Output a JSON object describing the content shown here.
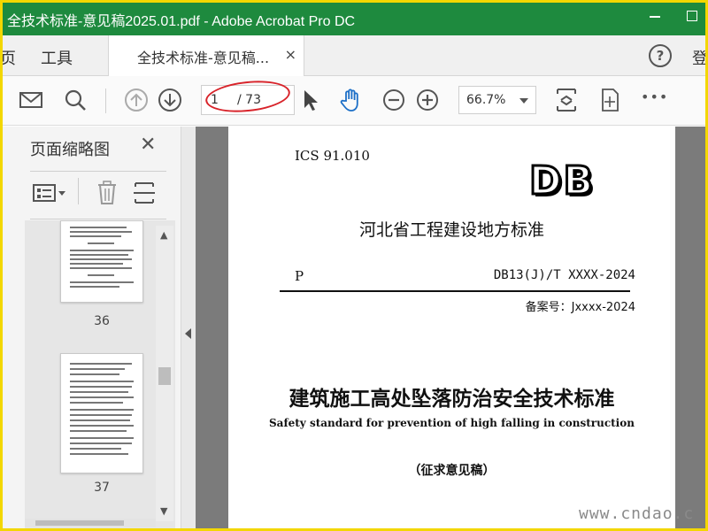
{
  "window": {
    "title": "全技术标准-意见稿2025.01.pdf - Adobe Acrobat Pro DC"
  },
  "nav": {
    "home": "页",
    "tools": "工具",
    "tab_label": "全技术标准-意见稿...",
    "tab_close": "×",
    "help": "?",
    "login": "登"
  },
  "toolbar": {
    "current_page": "1",
    "total_pages": "/ 73",
    "zoom": "66.7%",
    "more": "•••"
  },
  "panel": {
    "title": "页面缩略图",
    "close": "✕",
    "thumbnails": [
      {
        "number": "36"
      },
      {
        "number": "37"
      }
    ]
  },
  "document": {
    "ics": "ICS 91.010",
    "logo": "DB",
    "organization": "河北省工程建设地方标准",
    "category": "P",
    "code": "DB13(J)/T XXXX-2024",
    "record": "备案号：Jxxxx-2024",
    "title_cn": "建筑施工高处坠落防治安全技术标准",
    "title_en": "Safety standard for prevention of high falling in construction",
    "draft": "（征求意见稿）"
  },
  "watermark": "www.cndao.c"
}
